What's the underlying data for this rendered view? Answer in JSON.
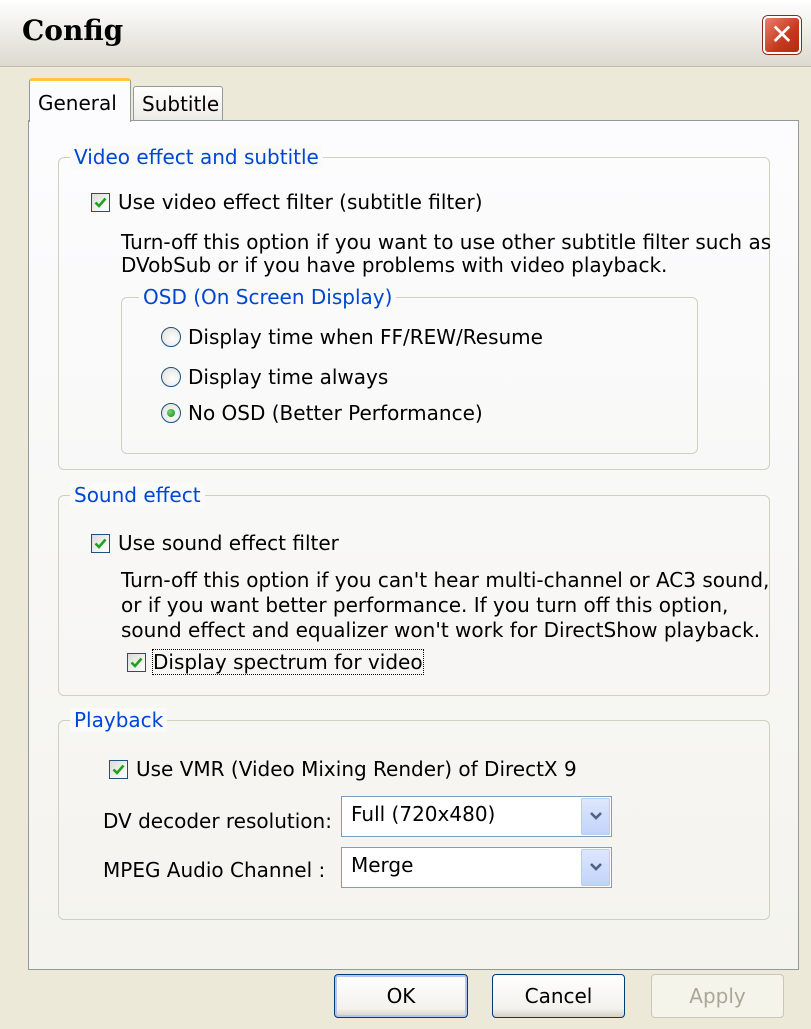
{
  "window": {
    "title": "Config",
    "close_glyph": "✕"
  },
  "tabs": [
    {
      "label": "General",
      "selected": true
    },
    {
      "label": "Subtitle",
      "selected": false
    }
  ],
  "video_group": {
    "legend": "Video effect and subtitle",
    "use_filter": {
      "label": "Use video effect filter (subtitle filter)",
      "checked": true
    },
    "desc_lines": [
      "Turn-off this option if you want to use other subtitle filter such as",
      "DVobSub or if you have problems with video playback."
    ],
    "osd": {
      "legend": "OSD (On Screen Display)",
      "options": [
        {
          "label": "Display time when FF/REW/Resume",
          "selected": false
        },
        {
          "label": "Display time always",
          "selected": false
        },
        {
          "label": "No OSD (Better Performance)",
          "selected": true
        }
      ]
    }
  },
  "sound_group": {
    "legend": "Sound effect",
    "use_filter": {
      "label": "Use sound effect filter",
      "checked": true
    },
    "desc_lines": [
      "Turn-off this option if you can't hear multi-channel or AC3 sound,",
      "or if you want better performance.  If you turn off this option,",
      "sound effect and equalizer won't work for DirectShow playback."
    ],
    "spectrum": {
      "label": "Display spectrum for video",
      "checked": true
    }
  },
  "playback_group": {
    "legend": "Playback",
    "vmr": {
      "label": "Use VMR (Video Mixing Render) of DirectX 9",
      "checked": true
    },
    "dv_decoder": {
      "label": "DV decoder resolution:",
      "value": "Full (720x480)"
    },
    "mpeg_audio": {
      "label": "MPEG Audio Channel :",
      "value": "Merge"
    }
  },
  "buttons": {
    "ok": "OK",
    "cancel": "Cancel",
    "apply": "Apply"
  },
  "colors": {
    "legend": "#0046d5",
    "tab_highlight": "#ffc83c",
    "close_button": "#c5391c"
  }
}
